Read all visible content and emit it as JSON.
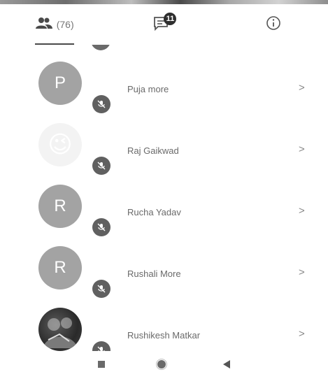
{
  "tabs": {
    "participants": {
      "icon": "group-icon",
      "count": "(76)"
    },
    "chat": {
      "icon": "chat-icon",
      "badge": "11"
    },
    "info": {
      "icon": "info-icon"
    }
  },
  "participants": [
    {
      "name": "Puja more",
      "avatar_type": "letter",
      "avatar_letter": "P",
      "mic_icon": "mic-off-icon"
    },
    {
      "name": "Raj Gaikwad",
      "avatar_type": "emoji",
      "avatar_emoji": "😉",
      "mic_icon": "mic-off-icon"
    },
    {
      "name": "Rucha Yadav",
      "avatar_type": "letter",
      "avatar_letter": "R",
      "mic_icon": "mic-off-icon"
    },
    {
      "name": "Rushali More",
      "avatar_type": "letter",
      "avatar_letter": "R",
      "mic_icon": "mic-off-icon"
    },
    {
      "name": "Rushikesh Matkar",
      "avatar_type": "photo",
      "mic_icon": "mic-off-icon"
    }
  ],
  "chevron": ">",
  "navbar": {
    "icons": [
      "recents-square-icon",
      "home-circle-icon",
      "back-triangle-icon"
    ]
  },
  "colors": {
    "avatar_gray": "#a3a3a3",
    "mic_badge": "#606060",
    "tab_indicator": "#4a4a4a"
  }
}
